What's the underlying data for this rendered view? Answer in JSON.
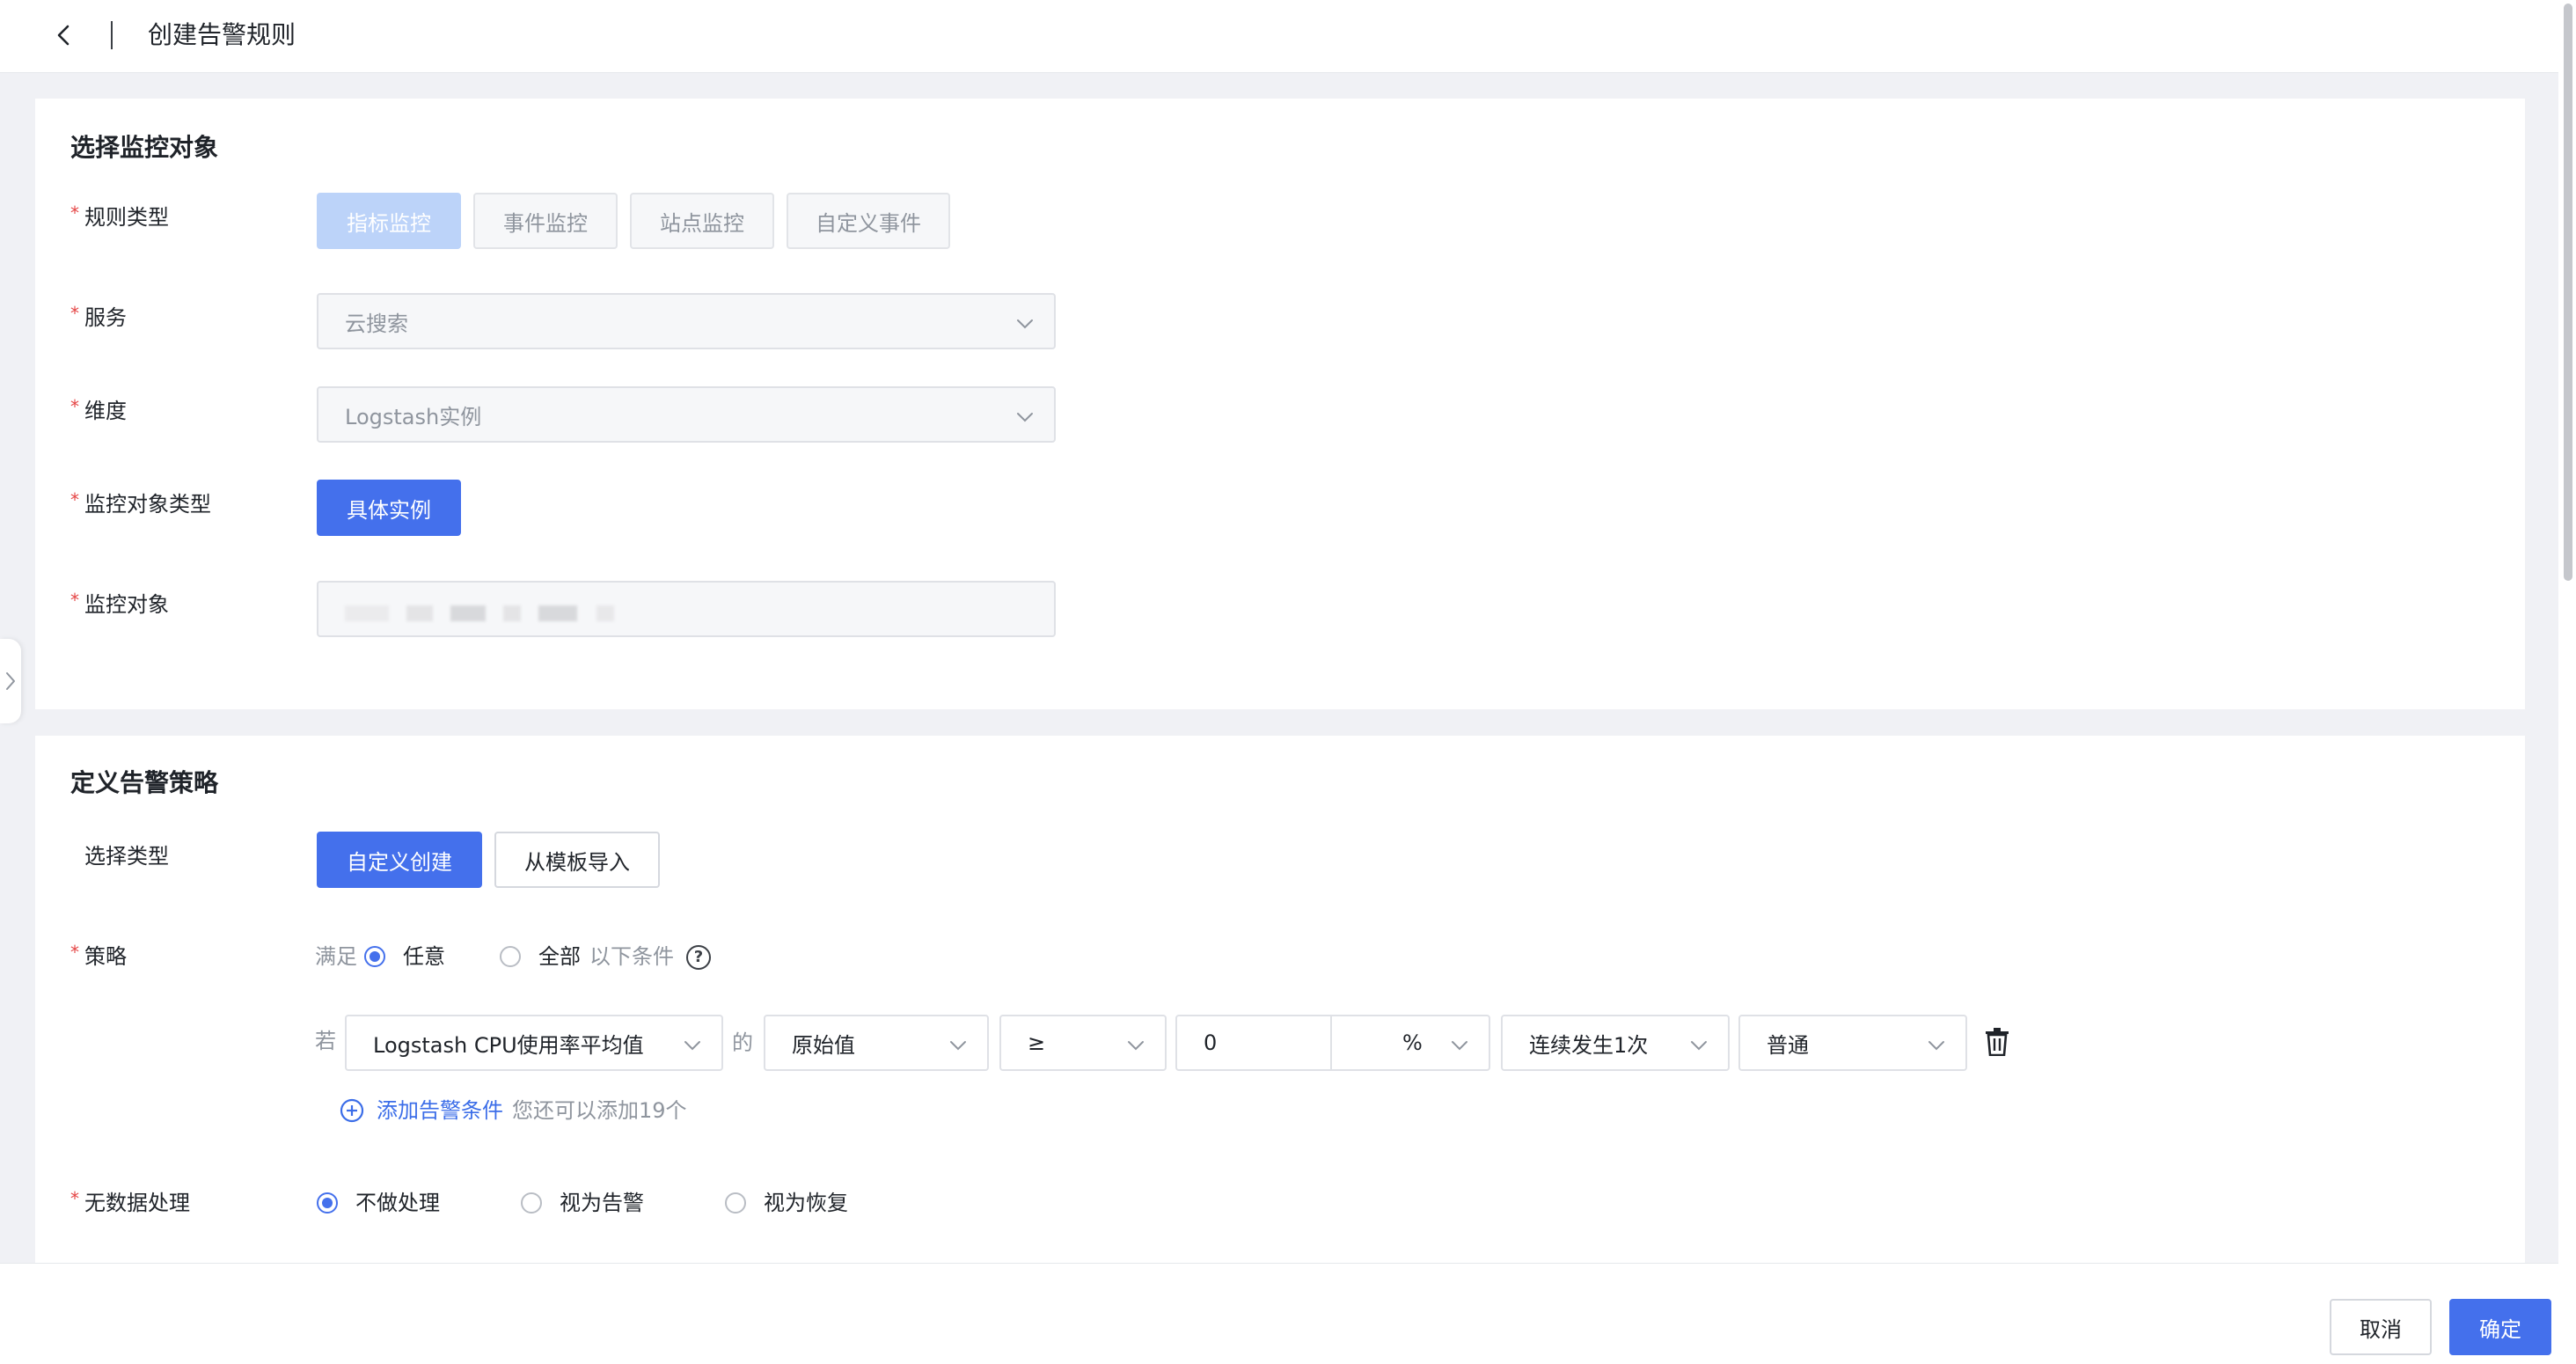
{
  "header": {
    "title": "创建告警规则"
  },
  "section1": {
    "title": "选择监控对象",
    "rule_type": {
      "label": "规则类型",
      "options": [
        "指标监控",
        "事件监控",
        "站点监控",
        "自定义事件"
      ],
      "selected": "指标监控"
    },
    "service": {
      "label": "服务",
      "value": "云搜索"
    },
    "dimension": {
      "label": "维度",
      "value": "Logstash实例"
    },
    "object_type": {
      "label": "监控对象类型",
      "value": "具体实例"
    },
    "object": {
      "label": "监控对象"
    }
  },
  "section2": {
    "title": "定义告警策略",
    "select_type": {
      "label": "选择类型",
      "options": [
        "自定义创建",
        "从模板导入"
      ],
      "selected": "自定义创建"
    },
    "policy": {
      "label": "策略",
      "prefix": "满足",
      "option_any": "任意",
      "option_all": "全部",
      "suffix": "以下条件",
      "selected": "任意"
    },
    "condition": {
      "if_label": "若",
      "metric": "Logstash CPU使用率平均值",
      "of_label": "的",
      "statistic": "原始值",
      "operator": "≥",
      "threshold": "0",
      "unit": "%",
      "occurrence": "连续发生1次",
      "severity": "普通"
    },
    "add_condition": {
      "link": "添加告警条件",
      "hint": "您还可以添加19个"
    },
    "no_data": {
      "label": "无数据处理",
      "options": [
        "不做处理",
        "视为告警",
        "视为恢复"
      ],
      "selected": "不做处理"
    }
  },
  "footer": {
    "cancel_label": "取消",
    "confirm_label": "确定"
  },
  "colors": {
    "primary": "#4470ec",
    "primary_disabled": "#bcd3f9",
    "required": "#e54545",
    "link": "#3b6de8"
  }
}
